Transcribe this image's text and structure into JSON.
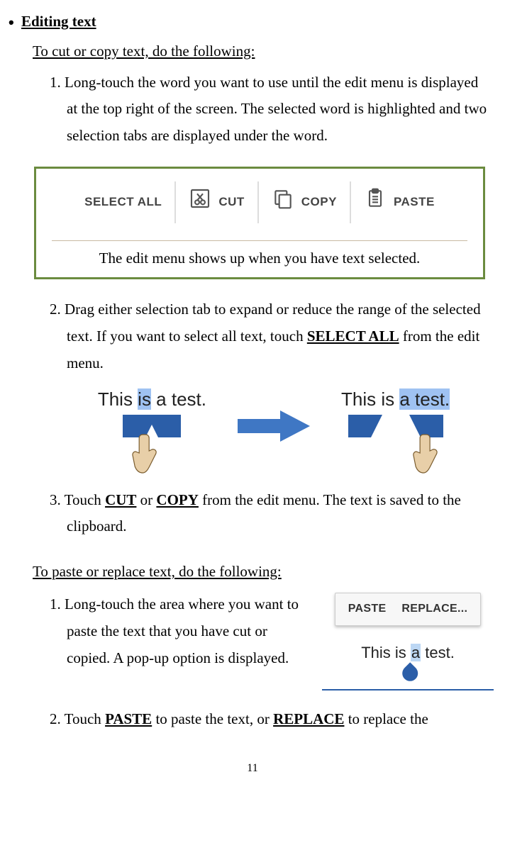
{
  "heading": {
    "bullet": "•",
    "title": "Editing text"
  },
  "section1": {
    "subhead": "To cut or copy text, do the following:  ",
    "step1_num": "1. ",
    "step1_text": "Long-touch the word you want to use until the edit menu is displayed at the top right of the screen. The selected word is highlighted and two selection tabs are displayed under the word.",
    "menu": {
      "select_all": "SELECT ALL",
      "cut": "CUT",
      "copy": "COPY",
      "paste": "PASTE"
    },
    "caption": "The edit menu shows up when you have text selected.",
    "step2_num": "2. ",
    "step2_a": "Drag either selection tab to expand or reduce the range of the selected text. If you want to select all text, touch ",
    "step2_bold": "SELECT ALL",
    "step2_b": " from the edit menu.",
    "sel_fig": {
      "left_text": "This is a test.",
      "right_pre": "This is ",
      "right_hl": "a test.",
      "right_text_full": "This is a test."
    },
    "step3_num": "3. ",
    "step3_a": "Touch ",
    "step3_cut": "CUT",
    "step3_or": " or ",
    "step3_copy": "COPY",
    "step3_b": " from the edit menu. The text is saved to the clipboard."
  },
  "section2": {
    "subhead": "To paste or replace text, do the following:",
    "step1_num": "1. ",
    "step1_text": " Long-touch the area where you want to paste the text that you have cut or copied. A pop-up option is displayed.",
    "popup": {
      "paste": "PASTE",
      "replace": "REPLACE..."
    },
    "cursor_pre": "This is ",
    "cursor_letter": "a",
    "cursor_post": " test.",
    "step2_num": "2. ",
    "step2_a": "Touch ",
    "step2_paste": "PASTE",
    "step2_b": " to paste the text, or ",
    "step2_replace": "REPLACE",
    "step2_c": " to replace the"
  },
  "page_number": "11"
}
